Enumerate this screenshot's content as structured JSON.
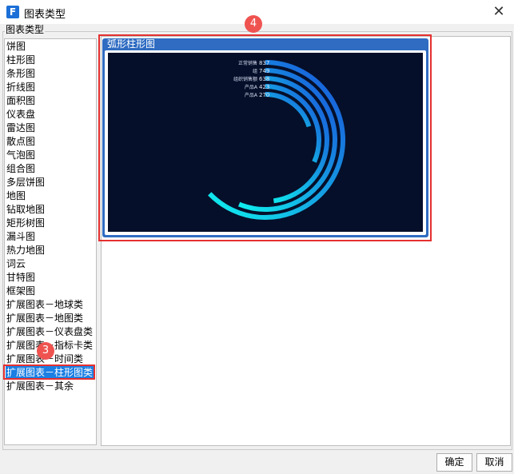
{
  "window": {
    "title": "图表类型",
    "app_icon_letter": "F"
  },
  "group_label": "图表类型",
  "chart_types": [
    "饼图",
    "柱形图",
    "条形图",
    "折线图",
    "面积图",
    "仪表盘",
    "雷达图",
    "散点图",
    "气泡图",
    "组合图",
    "多层饼图",
    "地图",
    "钻取地图",
    "矩形树图",
    "漏斗图",
    "热力地图",
    "词云",
    "甘特图",
    "框架图",
    "扩展图表－地球类",
    "扩展图表－地图类",
    "扩展图表－仪表盘类",
    "扩展图表－指标卡类",
    "扩展图表－时间类",
    "扩展图表－柱形图类",
    "扩展图表－其余"
  ],
  "selected_index": 24,
  "badges": {
    "step3": "3",
    "step4": "4"
  },
  "preview": {
    "label": "弧形柱形图",
    "chart_data": {
      "type": "bar",
      "categories": [
        "正常销售",
        "组",
        "组织销售额",
        "产品A",
        "产品A"
      ],
      "values": [
        837,
        749,
        638,
        423,
        270
      ],
      "colors": {
        "start": "#0ff0ee",
        "end": "#1a4fd8",
        "track": "#050f2a"
      }
    }
  },
  "buttons": {
    "ok": "确定",
    "cancel": "取消"
  }
}
